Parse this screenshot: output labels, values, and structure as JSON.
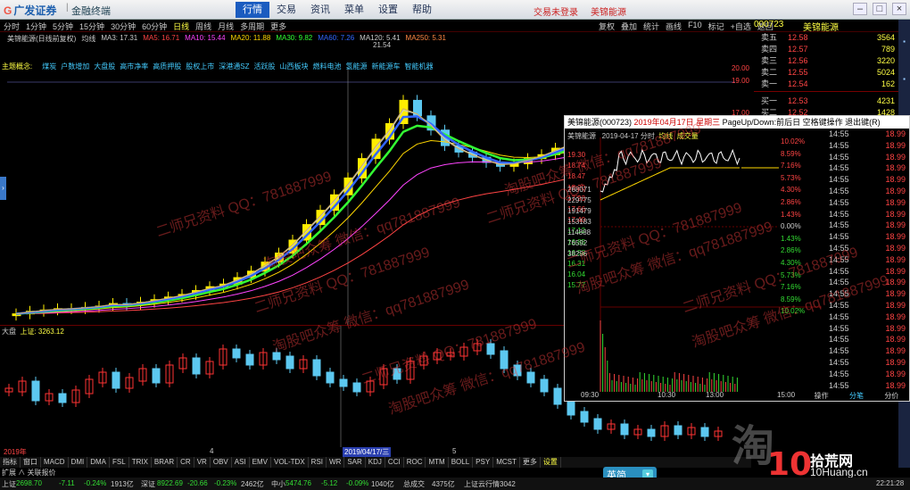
{
  "app": {
    "logo": "广发证券",
    "sub": "金融终端"
  },
  "menu": [
    "行情",
    "交易",
    "资讯",
    "菜单",
    "设置",
    "帮助"
  ],
  "top_links": [
    "交易未登录",
    "美锦能源"
  ],
  "period_left": [
    "分时",
    "1分钟",
    "5分钟",
    "15分钟",
    "30分钟",
    "60分钟",
    "日线",
    "周线",
    "月线",
    "多周期",
    "更多"
  ],
  "period_right": [
    "复权",
    "叠加",
    "统计",
    "画线",
    "F10",
    "标记",
    "+自选",
    "返回"
  ],
  "quote": {
    "code": "000723",
    "name": "美锦能源"
  },
  "kline": {
    "legend": [
      {
        "t": "美锦能源(日线前复权)",
        "c": "#cccccc"
      },
      {
        "t": "均线",
        "c": "#cccccc"
      },
      {
        "t": "MA3: 17.31",
        "c": "#cccccc"
      },
      {
        "t": "MA5: 16.71",
        "c": "#ff4444"
      },
      {
        "t": "MA10: 15.44",
        "c": "#ff44ff"
      },
      {
        "t": "MA20: 11.88",
        "c": "#ffd700"
      },
      {
        "t": "MA30: 9.82",
        "c": "#33ff33"
      },
      {
        "t": "MA60: 7.26",
        "c": "#3366ff"
      },
      {
        "t": "MA120: 5.41",
        "c": "#cccccc"
      },
      {
        "t": "MA250: 5.31",
        "c": "#ff8844"
      }
    ],
    "concept_label": "主题概念:",
    "concepts": [
      "煤炭",
      "户数增加",
      "大盘股",
      "高市净率",
      "高质押股",
      "股权上市",
      "深港通SZ",
      "活跃股",
      "山西板块",
      "燃料电池",
      "氢能源",
      "新能源车",
      "智能机器"
    ],
    "price_marks": [
      "20.00",
      "19.00",
      "17.00"
    ],
    "high_label": "21.54",
    "chart_data": {
      "type": "candlestick",
      "title": "美锦能源(日线前复权)",
      "close_approx": [
        4.3,
        4.5,
        4.6,
        4.7,
        4.7,
        4.8,
        4.9,
        5.1,
        5.0,
        5.2,
        5.4,
        5.6,
        5.8,
        6.1,
        6.4,
        6.6,
        7.1,
        7.6,
        8.3,
        9.0,
        10.0,
        11.2,
        12.3,
        13.5,
        14.8,
        16.3,
        17.8,
        19.0,
        20.8,
        19.6,
        18.5,
        17.3,
        16.8,
        16.4,
        16.0,
        15.7,
        15.9,
        16.3,
        16.6,
        17.1,
        17.5
      ]
    }
  },
  "book": [
    {
      "k": "卖五",
      "p": "12.58",
      "v": "3564"
    },
    {
      "k": "卖四",
      "p": "12.57",
      "v": "789"
    },
    {
      "k": "卖三",
      "p": "12.56",
      "v": "3220"
    },
    {
      "k": "卖二",
      "p": "12.55",
      "v": "5024"
    },
    {
      "k": "卖一",
      "p": "12.54",
      "v": "162"
    },
    {
      "k": "买一",
      "p": "12.53",
      "v": "4231"
    },
    {
      "k": "买二",
      "p": "12.52",
      "v": "1428"
    }
  ],
  "sub": {
    "label": "大盘",
    "index": "上证: 3263.12"
  },
  "date_axis": {
    "left": "2019年",
    "mark2": "4",
    "mark3": "5",
    "current": "2019/04/17/三"
  },
  "ind_tabs": [
    "指标",
    "窗口",
    "MACD",
    "DMI",
    "DMA",
    "FSL",
    "TRIX",
    "BRAR",
    "CR",
    "VR",
    "OBV",
    "ASI",
    "EMV",
    "VOL-TDX",
    "RSI",
    "WR",
    "SAR",
    "KDJ",
    "CCI",
    "ROC",
    "MTM",
    "BOLL",
    "PSY",
    "MCST",
    "更多",
    "设置"
  ],
  "ext_row": "扩展 ∧ 关联报价",
  "popup": {
    "title": "美锦能源(000723)",
    "date": "2019年04月17日 星期三",
    "hint": "PageUp/Down:前后日  空格键操作  退出键(R)",
    "sub_name": "美锦能源",
    "sub_date": "2019-04-17 分时",
    "sub_vol": "均线",
    "sub_extra": "成交量",
    "left_axis": [
      "19.30",
      "18.74",
      "18.47",
      "18.20",
      "17.93",
      "17.66",
      "17.40",
      "17.12",
      "16.85",
      "16.58",
      "16.31",
      "16.04",
      "15.77",
      "268071",
      "229775",
      "191479",
      "153183",
      "114888",
      "76592",
      "38296"
    ],
    "right_axis": [
      "10.02%",
      "8.59%",
      "7.16%",
      "5.73%",
      "4.30%",
      "2.86%",
      "1.43%",
      "0.00%",
      "1.43%",
      "2.86%",
      "4.30%",
      "5.73%",
      "7.16%",
      "8.59%",
      "10.02%"
    ],
    "time_axis": [
      "09:30",
      "10:30",
      "13:00",
      "15:00"
    ],
    "tabs": [
      "操作",
      "分笔",
      "分价"
    ],
    "ticks": [
      {
        "t": "14:55",
        "p": "18.99"
      },
      {
        "t": "14:55",
        "p": "18.99"
      },
      {
        "t": "14:55",
        "p": "18.99"
      },
      {
        "t": "14:55",
        "p": "18.99"
      },
      {
        "t": "14:55",
        "p": "18.99"
      },
      {
        "t": "14:55",
        "p": "18.99"
      },
      {
        "t": "14:55",
        "p": "18.99"
      },
      {
        "t": "14:55",
        "p": "18.99"
      },
      {
        "t": "14:55",
        "p": "18.99"
      },
      {
        "t": "14:55",
        "p": "18.99"
      },
      {
        "t": "14:55",
        "p": "18.99"
      },
      {
        "t": "14:55",
        "p": "18.99"
      },
      {
        "t": "14:55",
        "p": "18.99"
      },
      {
        "t": "14:55",
        "p": "18.99"
      },
      {
        "t": "14:55",
        "p": "18.99"
      },
      {
        "t": "14:55",
        "p": "18.99"
      },
      {
        "t": "14:55",
        "p": "18.99"
      },
      {
        "t": "14:55",
        "p": "18.99"
      },
      {
        "t": "14:55",
        "p": "18.99"
      },
      {
        "t": "14:55",
        "p": "18.99"
      },
      {
        "t": "14:55",
        "p": "18.99"
      },
      {
        "t": "14:55",
        "p": "18.99"
      },
      {
        "t": "14:55",
        "p": "18.99"
      }
    ]
  },
  "watermarks": [
    {
      "t": "二师兄资料    QQ：781887999"
    },
    {
      "t": "淘股吧众筹  微信：qq781887999"
    }
  ],
  "overlay": {
    "big": "淘",
    "ten": "10",
    "cn": "拾荒网",
    "url": "10Huang.cn",
    "ime": "英简"
  },
  "status": {
    "sh_label": "上证",
    "sh_val": "2698.70",
    "sh_chg": "-7.11",
    "sh_pct": "-0.24%",
    "sh_amt": "1913亿",
    "sz_label": "深证",
    "sz_val": "8922.69",
    "sz_chg": "-20.66",
    "sz_pct": "-0.23%",
    "sz_amt": "2462亿",
    "zx_label": "中小",
    "zx_val": "5474.76",
    "zx_chg": "-5.12",
    "zx_pct": "-0.09%",
    "zx_amt": "1040亿",
    "total_label": "总成交",
    "total_val": "4375亿",
    "cloud": "上证云行情3042",
    "time": "22:21:28"
  }
}
